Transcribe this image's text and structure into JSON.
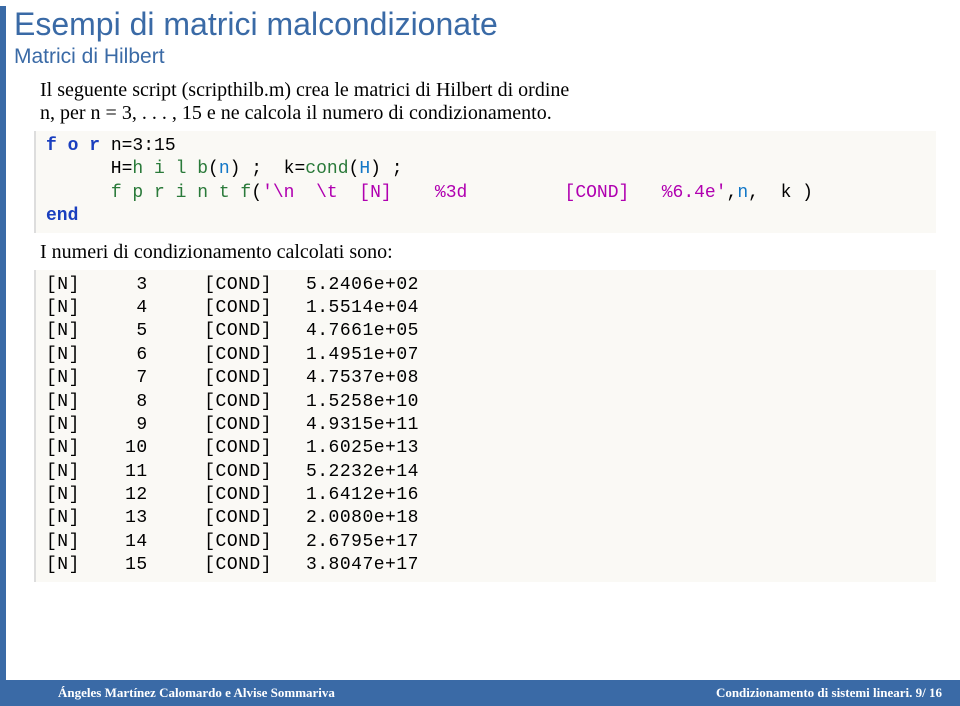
{
  "title": "Esempi di matrici malcondizionate",
  "subtitle": "Matrici di Hilbert",
  "intro_a": "Il seguente script (scripthilb.m) crea le matrici di Hilbert di ordine",
  "intro_b": "n, per n = 3, . . . , 15 e ne calcola il numero di condizionamento.",
  "code": {
    "l1a": "f o r",
    "l1b": " n=3:15",
    "l2a": "      H=",
    "l2b": "h i l b",
    "l2c": "(",
    "l2d": "n",
    "l2e": ") ;  k=",
    "l2f": "cond",
    "l2g": "(",
    "l2h": "H",
    "l2i": ") ;",
    "l3a": "      ",
    "l3b": "f p r i n t f",
    "l3c": "(",
    "l3d": "'\\n  \\t  [N]    %3d         [COND]   %6.4e'",
    "l3e": ",",
    "l3f": "n",
    "l3g": ",  k )",
    "l4": "end"
  },
  "midtext": "I numeri di condizionamento calcolati sono:",
  "out": [
    {
      "n": "3",
      "c": "5.2406e+02"
    },
    {
      "n": "4",
      "c": "1.5514e+04"
    },
    {
      "n": "5",
      "c": "4.7661e+05"
    },
    {
      "n": "6",
      "c": "1.4951e+07"
    },
    {
      "n": "7",
      "c": "4.7537e+08"
    },
    {
      "n": "8",
      "c": "1.5258e+10"
    },
    {
      "n": "9",
      "c": "4.9315e+11"
    },
    {
      "n": "10",
      "c": "1.6025e+13"
    },
    {
      "n": "11",
      "c": "5.2232e+14"
    },
    {
      "n": "12",
      "c": "1.6412e+16"
    },
    {
      "n": "13",
      "c": "2.0080e+18"
    },
    {
      "n": "14",
      "c": "2.6795e+17"
    },
    {
      "n": "15",
      "c": "3.8047e+17"
    }
  ],
  "footer_left": "Ángeles Martínez Calomardo e Alvise Sommariva",
  "footer_right": "Condizionamento di sistemi lineari.      9/ 16"
}
